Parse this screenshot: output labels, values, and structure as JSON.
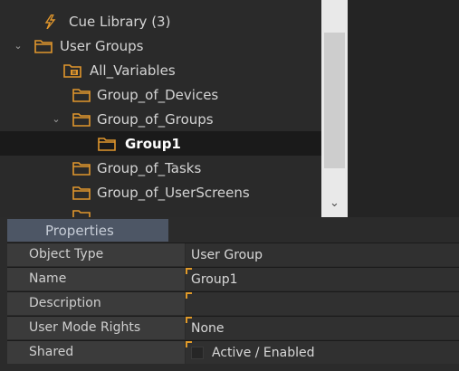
{
  "tree": {
    "items": [
      {
        "label": "Cue Library (3)",
        "icon": "bolt-icon",
        "chevron": ""
      },
      {
        "label": "User Groups",
        "icon": "folder-icon",
        "chevron": "expanded"
      },
      {
        "label": "All_Variables",
        "icon": "variables-folder-icon",
        "chevron": ""
      },
      {
        "label": "Group_of_Devices",
        "icon": "folder-icon",
        "chevron": ""
      },
      {
        "label": "Group_of_Groups",
        "icon": "folder-icon",
        "chevron": "expanded"
      },
      {
        "label": "Group1",
        "icon": "folder-icon",
        "chevron": "",
        "selected": true
      },
      {
        "label": "Group_of_Tasks",
        "icon": "folder-icon",
        "chevron": ""
      },
      {
        "label": "Group_of_UserScreens",
        "icon": "folder-icon",
        "chevron": ""
      }
    ],
    "chevron_glyph": "⌄",
    "scroll_down_glyph": "⌄"
  },
  "properties": {
    "tab_label": "Properties",
    "rows": [
      {
        "key": "Object Type",
        "value": "User Group",
        "editable": false
      },
      {
        "key": "Name",
        "value": "Group1",
        "editable": true
      },
      {
        "key": "Description",
        "value": "",
        "editable": true
      },
      {
        "key": "User Mode Rights",
        "value": "None",
        "editable": true
      },
      {
        "key": "Shared",
        "value": "Active / Enabled",
        "editable": true,
        "checkbox": true,
        "checked": false
      }
    ]
  },
  "colors": {
    "folder": "#e0962c",
    "accent_mark": "#e09a2a",
    "tab_bg": "#4d5665"
  }
}
